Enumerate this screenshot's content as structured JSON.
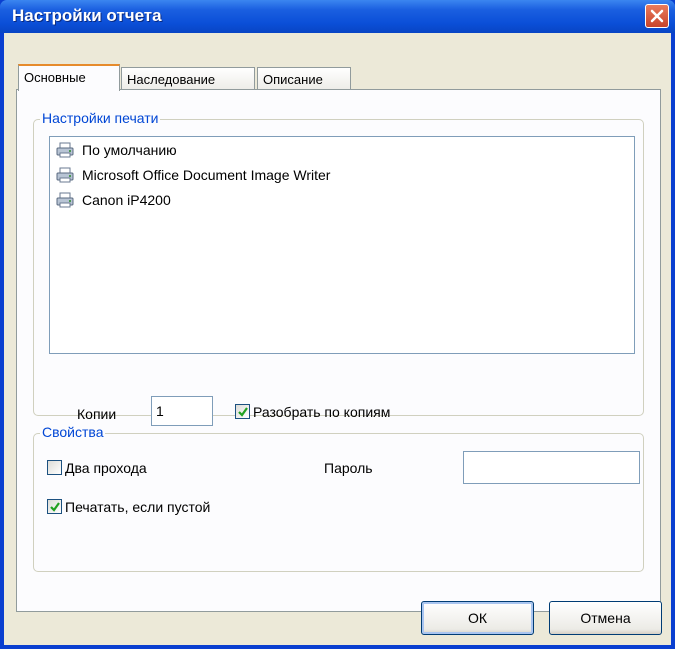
{
  "window": {
    "title": "Настройки отчета"
  },
  "tabs": [
    {
      "label": "Основные",
      "active": true
    },
    {
      "label": "Наследование",
      "active": false
    },
    {
      "label": "Описание",
      "active": false
    }
  ],
  "print_settings": {
    "group_label": "Настройки печати",
    "printers": [
      {
        "name": "По умолчанию",
        "icon": "printer-icon"
      },
      {
        "name": "Microsoft Office Document Image Writer",
        "icon": "printer-icon"
      },
      {
        "name": "Canon iP4200",
        "icon": "printer-icon"
      }
    ],
    "copies_label": "Копии",
    "copies_value": "1",
    "collate_label": "Разобрать по копиям",
    "collate_checked": true
  },
  "properties": {
    "group_label": "Свойства",
    "two_pass_label": "Два прохода",
    "two_pass_checked": false,
    "password_label": "Пароль",
    "password_value": "",
    "print_if_empty_label": "Печатать, если пустой",
    "print_if_empty_checked": true
  },
  "buttons": {
    "ok": "ОК",
    "cancel": "Отмена"
  },
  "colors": {
    "titlebar": "#0b4fd8",
    "group_label": "#0046d5",
    "close": "#c8432a"
  }
}
